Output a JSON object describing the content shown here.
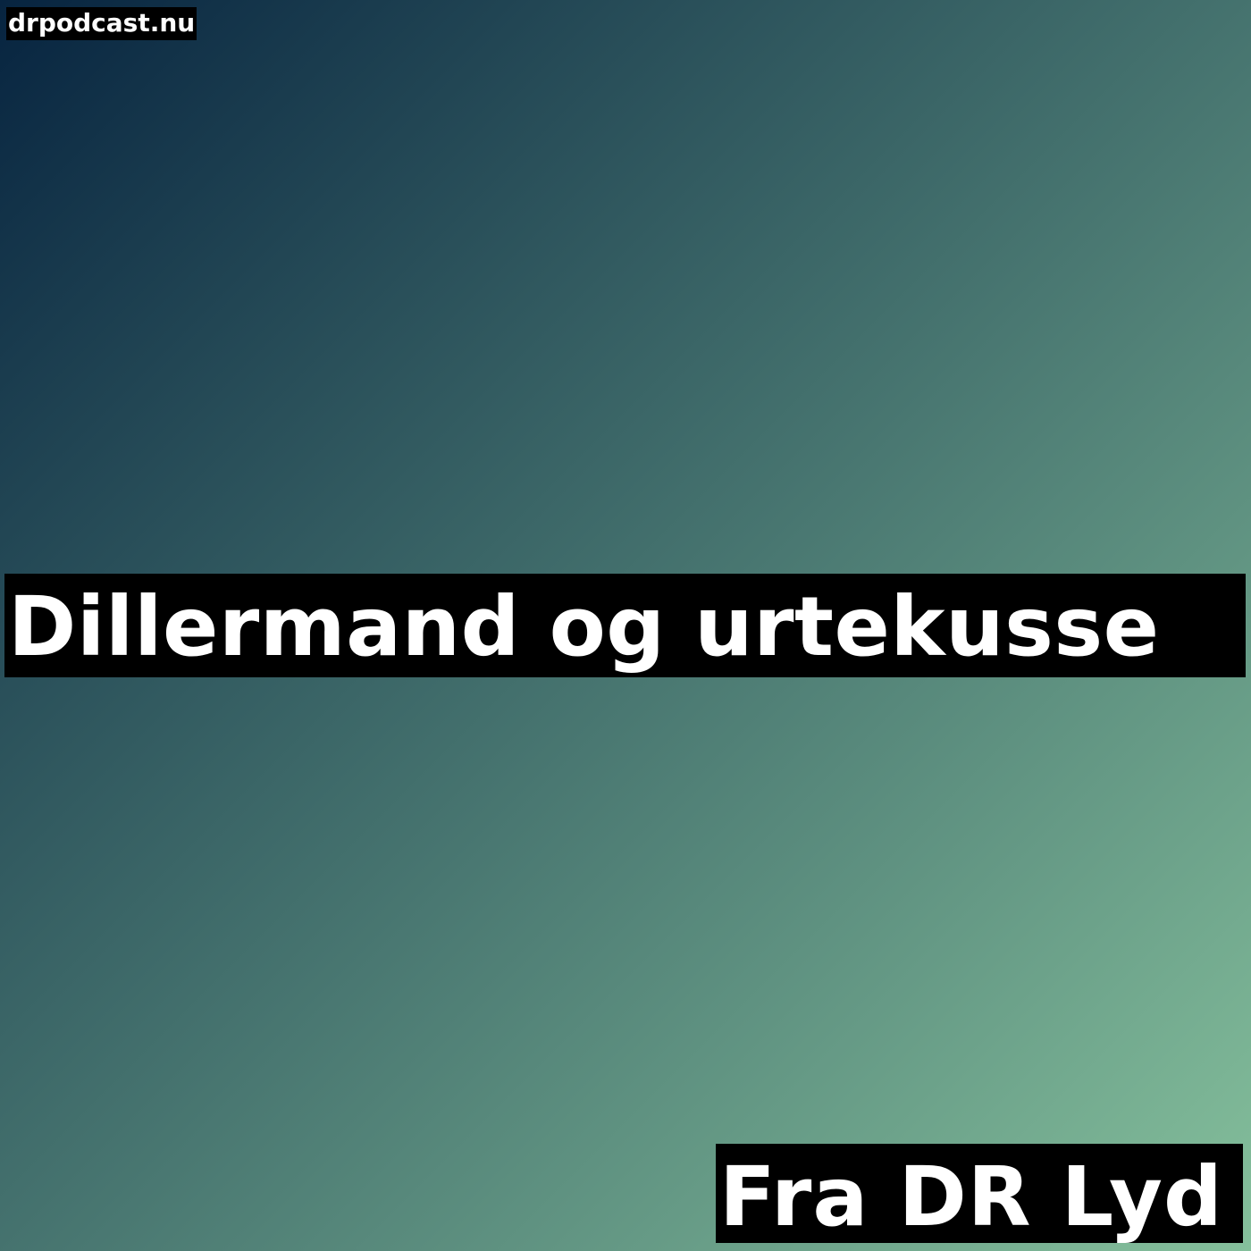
{
  "cover": {
    "site": "drpodcast.nu",
    "title": "Dillermand og urtekusse",
    "credit": "Fra DR Lyd",
    "colors": {
      "gradient_start": "#072440",
      "gradient_mid": "#3f6b6a",
      "gradient_end": "#85c09c",
      "label_background": "#000000",
      "label_text": "#ffffff"
    }
  }
}
